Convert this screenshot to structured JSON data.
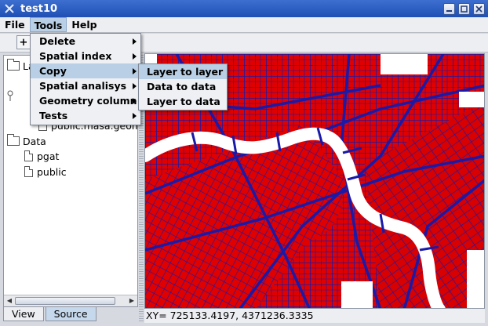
{
  "window": {
    "title": "test10"
  },
  "menubar": {
    "items": [
      "File",
      "Tools",
      "Help"
    ]
  },
  "toolbar": {
    "add_label": "+"
  },
  "tree": {
    "nodes": [
      {
        "label": "La",
        "kind": "folder"
      },
      {
        "label": "public.masa.geom",
        "kind": "doc"
      },
      {
        "label": "Data",
        "kind": "folder"
      },
      {
        "label": "pgat",
        "kind": "doc"
      },
      {
        "label": "public",
        "kind": "doc"
      }
    ]
  },
  "tabs": [
    "View",
    "Source"
  ],
  "status": {
    "coords": "XY= 725133.4197, 4371236.3335"
  },
  "tools_menu": {
    "items": [
      "Delete",
      "Spatial index",
      "Copy",
      "Spatial analisys",
      "Geometry column",
      "Tests"
    ]
  },
  "copy_submenu": {
    "items": [
      "Layer to layer",
      "Data to data",
      "Layer to data"
    ]
  },
  "colors": {
    "titlebar": "#2a5cc4",
    "highlight": "#b8cfe5",
    "map_blocks": "#ff0000",
    "map_streets": "#1a1aa8",
    "river": "#ffffff"
  },
  "icons": {
    "app": "app-icon",
    "minimize": "minimize-icon",
    "maximize": "maximize-icon",
    "close": "close-icon"
  }
}
